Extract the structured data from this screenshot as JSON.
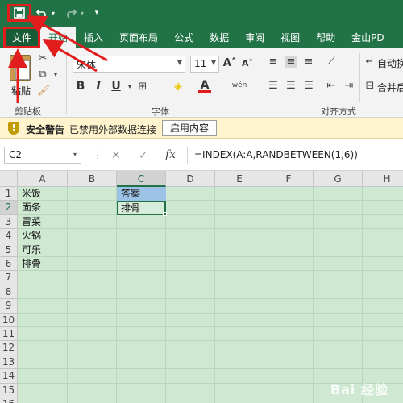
{
  "colors": {
    "accent": "#217346",
    "annotation_red": "#e11d1d",
    "highlight": "#9cc3e5",
    "grid_bg": "#cfe8d2"
  },
  "quick_access": {
    "save_icon": "save-icon",
    "undo_icon": "undo-icon",
    "redo_icon": "redo-icon",
    "more_icon": "▾"
  },
  "tabs": [
    {
      "label": "文件",
      "active": false
    },
    {
      "label": "开始",
      "active": true
    },
    {
      "label": "插入",
      "active": false
    },
    {
      "label": "页面布局",
      "active": false
    },
    {
      "label": "公式",
      "active": false
    },
    {
      "label": "数据",
      "active": false
    },
    {
      "label": "审阅",
      "active": false
    },
    {
      "label": "视图",
      "active": false
    },
    {
      "label": "帮助",
      "active": false
    },
    {
      "label": "金山PD",
      "active": false
    }
  ],
  "ribbon": {
    "paste_label": "粘贴",
    "clipboard_label": "剪贴板",
    "font_name": "宋体",
    "font_size": "11",
    "font_group_label": "字体",
    "bold": "B",
    "italic": "I",
    "underline": "U",
    "grow_font": "A˄",
    "shrink_font": "A˅",
    "font_color_letter": "A",
    "phonetic": "wén",
    "alignment_group_label": "对齐方式",
    "wrap_label": "自动换",
    "merge_label": "合并后"
  },
  "security_bar": {
    "title": "安全警告",
    "message": "已禁用外部数据连接",
    "button": "启用内容"
  },
  "formula_bar": {
    "name_box": "C2",
    "fx": "fx",
    "formula": "=INDEX(A:A,RANDBETWEEN(1,6))"
  },
  "columns": [
    "A",
    "B",
    "C",
    "D",
    "E",
    "F",
    "G",
    "H"
  ],
  "rows": [
    "1",
    "2",
    "3",
    "4",
    "5",
    "6",
    "7",
    "8",
    "9",
    "10",
    "11",
    "12",
    "13",
    "14",
    "15",
    "16"
  ],
  "cells": {
    "A1": "米饭",
    "A2": "面条",
    "A3": "冒菜",
    "A4": "火锅",
    "A5": "可乐",
    "A6": "排骨",
    "C1": "答案",
    "C2": "排骨"
  },
  "watermark": "Bai 经验"
}
